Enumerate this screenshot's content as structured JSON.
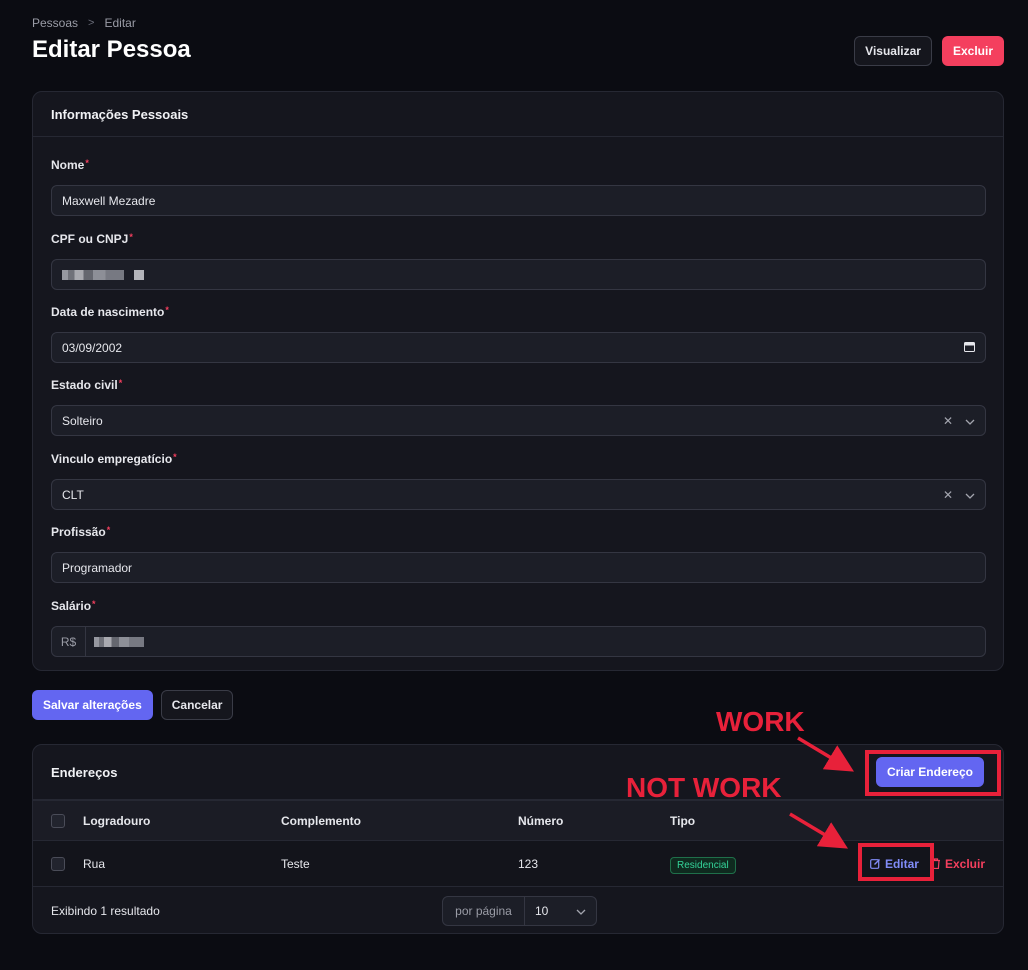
{
  "breadcrumb": {
    "root": "Pessoas",
    "separator": ">",
    "current": "Editar"
  },
  "page_title": "Editar Pessoa",
  "header_actions": {
    "view": "Visualizar",
    "delete": "Excluir"
  },
  "personal_info": {
    "title": "Informações Pessoais",
    "required_mark": "*",
    "fields": {
      "nome": {
        "label": "Nome",
        "value": "Maxwell Mezadre"
      },
      "cpf": {
        "label": "CPF ou CNPJ"
      },
      "nascimento": {
        "label": "Data de nascimento",
        "value": "03/09/2002"
      },
      "estado_civil": {
        "label": "Estado civil",
        "value": "Solteiro"
      },
      "vinculo": {
        "label": "Vinculo empregatício",
        "value": "CLT"
      },
      "profissao": {
        "label": "Profissão",
        "value": "Programador"
      },
      "salario": {
        "label": "Salário",
        "prefix": "R$"
      }
    }
  },
  "form_actions": {
    "save": "Salvar alterações",
    "cancel": "Cancelar"
  },
  "addresses": {
    "title": "Endereços",
    "create_button": "Criar Endereço",
    "columns": [
      "Logradouro",
      "Complemento",
      "Número",
      "Tipo"
    ],
    "rows": [
      {
        "logradouro": "Rua",
        "complemento": "Teste",
        "numero": "123",
        "tipo": "Residencial",
        "edit": "Editar",
        "delete": "Excluir"
      }
    ],
    "footer": {
      "count": "Exibindo 1 resultado",
      "per_page_label": "por página",
      "per_page_value": "10"
    }
  },
  "annotations": {
    "work": "WORK",
    "not_work": "NOT WORK"
  },
  "colors": {
    "accent": "#6366f1",
    "danger": "#f43f5e",
    "success": "#34d399",
    "annotation": "#e8213a"
  }
}
